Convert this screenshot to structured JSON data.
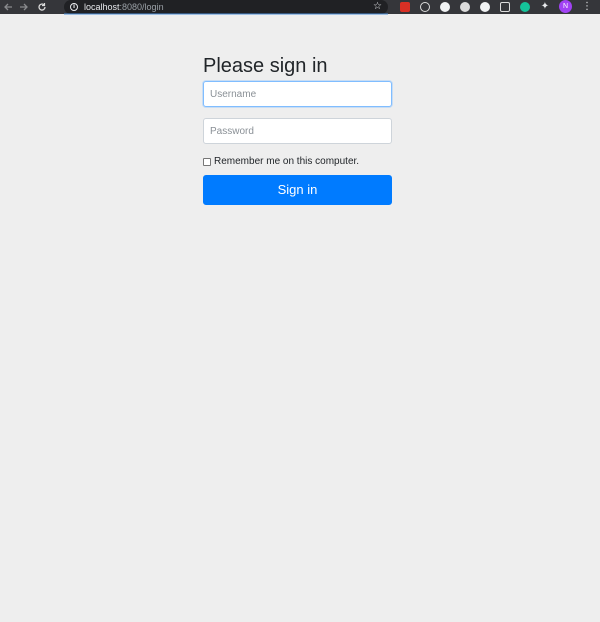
{
  "browser": {
    "url_host": "localhost",
    "url_rest": ":8080/login",
    "avatar_initial": "N",
    "nav": {
      "back_icon": "arrow-left-icon",
      "forward_icon": "arrow-right-icon",
      "reload_icon": "reload-icon"
    },
    "extensions": [
      "pdf-extension-icon",
      "react-devtools-icon",
      "circle-extension-icon",
      "record-extension-icon",
      "moon-extension-icon",
      "grid-extension-icon",
      "grammarly-icon",
      "puzzle-extensions-icon"
    ],
    "colors": {
      "chrome_bg": "#35363a",
      "omnibox_bg": "#202124",
      "avatar_bg": "#a142f4"
    }
  },
  "signin": {
    "heading": "Please sign in",
    "username_placeholder": "Username",
    "password_placeholder": "Password",
    "remember_label": "Remember me on this computer.",
    "remember_checked": false,
    "submit_label": "Sign in"
  },
  "colors": {
    "page_bg": "#eeeeee",
    "primary": "#007bff",
    "focus_border": "#80bdff",
    "text": "#212529"
  }
}
